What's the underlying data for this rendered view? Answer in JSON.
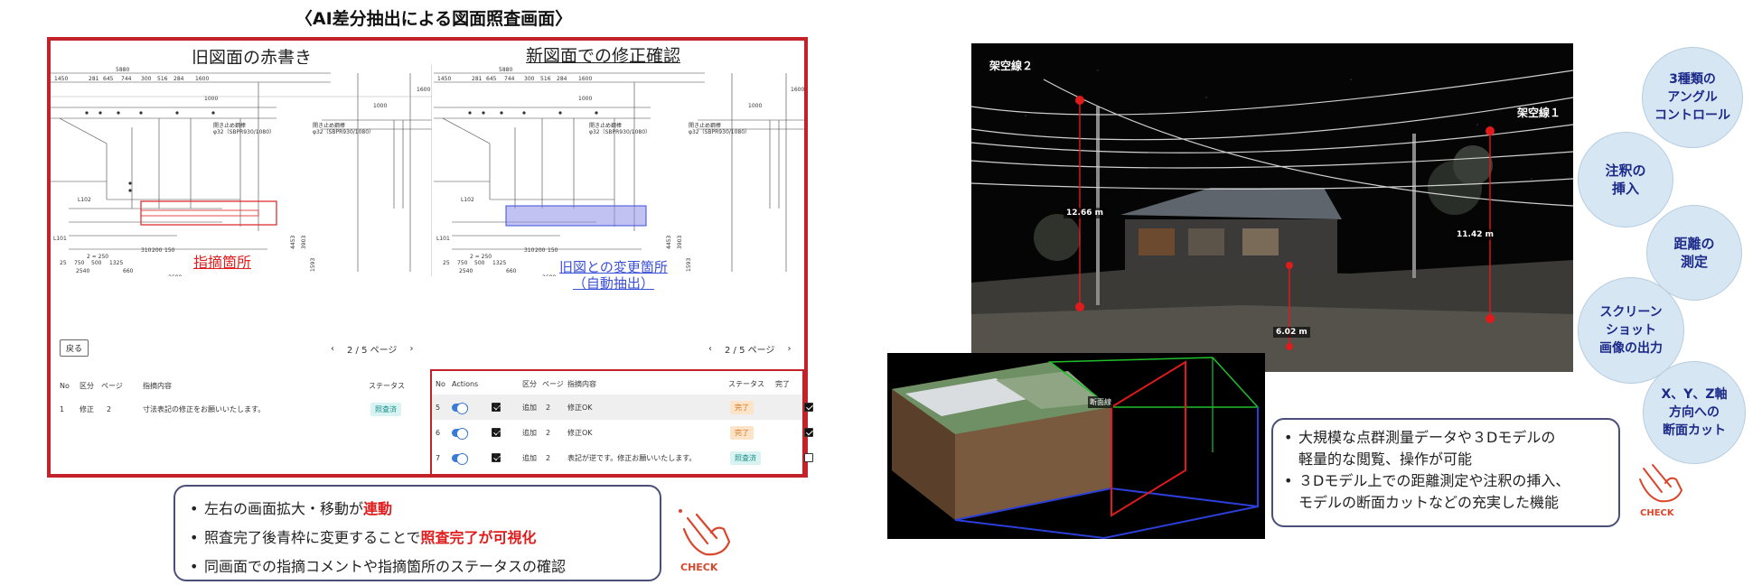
{
  "left_panel": {
    "title": "〈AI差分抽出による図面照査画面〉",
    "old_pane_title": "旧図面の赤書き",
    "new_pane_title": "新図面での修正確認",
    "red_annotation": "指摘箇所",
    "blue_annotation_line1": "旧図との変更箇所",
    "blue_annotation_line2": "（自動抽出）",
    "back_button": "戻る",
    "pager_left": {
      "prev": "‹",
      "label": "2 / 5 ページ",
      "next": "›"
    },
    "pager_right": {
      "prev": "‹",
      "label": "2 / 5 ページ",
      "next": "›"
    },
    "drawing_dims": {
      "top": "5880",
      "row1": [
        "1450",
        "281",
        "645",
        "744",
        "300",
        "516",
        "284",
        "1600"
      ],
      "row2": [
        "1000"
      ],
      "side_label": "開きまめ鋼棒",
      "side_spec": "φ32（SBPR930/1080）",
      "side_vals": [
        "1000",
        "1600"
      ],
      "bottom": [
        "2540",
        "660",
        "2680"
      ],
      "left_vals": [
        "4453",
        "3903",
        "1593"
      ],
      "mid_vals": [
        "2 = 250",
        "750",
        "500",
        "1325",
        "310",
        "200",
        "150"
      ]
    },
    "left_table": {
      "headers": [
        "No",
        "区分",
        "ページ",
        "指摘内容",
        "ステータス"
      ],
      "rows": [
        {
          "no": "1",
          "kubun": "修正",
          "page": "2",
          "content": "寸法表記の修正をお願いいたします。",
          "status": "照査済"
        }
      ]
    },
    "right_table": {
      "headers": [
        "No",
        "Actions",
        "区分",
        "ページ",
        "指摘内容",
        "ステータス",
        "完了"
      ],
      "rows": [
        {
          "no": "5",
          "kubun": "追加",
          "page": "2",
          "content": "修正OK",
          "status": "完了",
          "status_type": "done",
          "complete": true
        },
        {
          "no": "6",
          "kubun": "追加",
          "page": "2",
          "content": "修正OK",
          "status": "完了",
          "status_type": "done",
          "complete": true
        },
        {
          "no": "7",
          "kubun": "追加",
          "page": "2",
          "content": "表記が逆です。修正お願いいたします。",
          "status": "照査済",
          "status_type": "open",
          "complete": false
        }
      ]
    },
    "notes": {
      "line1_pre": "左右の画面拡大・移動が",
      "line1_hl": "連動",
      "line2_pre": "照査完了後青枠に変更することで",
      "line2_hl": "照査完了が可視化",
      "line3": "同画面での指摘コメントや指摘箇所のステータスの確認"
    },
    "check_label": "CHECK"
  },
  "right_panel": {
    "wire_label_2": "架空線２",
    "wire_label_1": "架空線１",
    "measurements": [
      "12.66 m",
      "11.42 m",
      "6.02 m"
    ],
    "model_label": "断面線",
    "notes": {
      "line1a": "大規模な点群測量データや３Dモデルの",
      "line1b": "軽量的な閲覧、操作が可能",
      "line2a": "３Dモデル上での距離測定や注釈の挿入、",
      "line2b": "モデルの断面カットなどの充実した機能"
    },
    "check_label": "CHECK",
    "features": [
      "3種類の\nアングル\nコントロール",
      "注釈の\n挿入",
      "距離の\n測定",
      "スクリーン\nショット\n画像の出力",
      "X、Y、Z軸\n方向への\n断面カット"
    ]
  },
  "colors": {
    "frame_red": "#c4222b",
    "annotation_red": "#e02020",
    "annotation_blue": "#3b50d8",
    "bubble_fill": "#d6e6f2",
    "bubble_text": "#1c2a8a",
    "note_border": "#4a4f7a"
  }
}
